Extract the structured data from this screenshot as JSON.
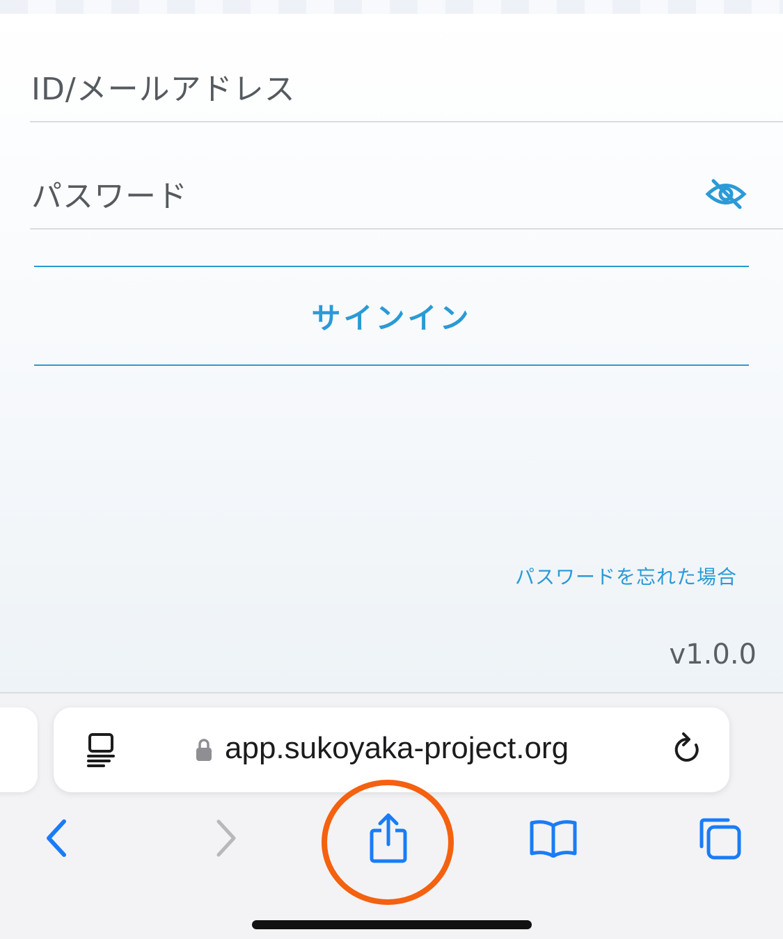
{
  "login": {
    "id_placeholder": "ID/メールアドレス",
    "password_placeholder": "パスワード",
    "signin_label": "サインイン",
    "forgot_password": "パスワードを忘れた場合",
    "version": "v1.0.0"
  },
  "browser": {
    "url": "app.sukoyaka-project.org",
    "toolbar_icons": [
      "back-icon",
      "forward-icon",
      "share-icon",
      "bookmarks-icon",
      "tabs-icon"
    ],
    "highlighted": "share-icon"
  },
  "colors": {
    "accent": "#2a9ad6",
    "highlight_ring": "#f4610f",
    "ios_blue": "#1a7cf5",
    "disabled": "#b8b8bc"
  }
}
